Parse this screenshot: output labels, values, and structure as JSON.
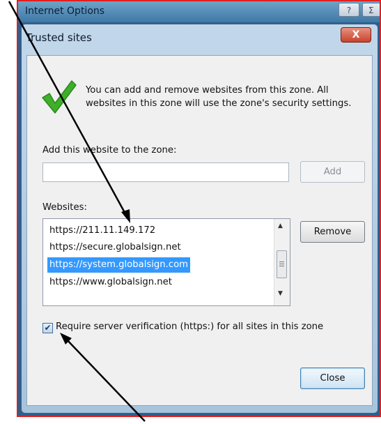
{
  "outer_window": {
    "title": "Internet Options",
    "help_button": "?",
    "close_button_partial": "Σ"
  },
  "dialog": {
    "title": "Trusted sites",
    "close_button": "X",
    "info_text": "You can add and remove websites from this zone. All websites in this zone will use the zone's security settings.",
    "add_label": "Add this website to the zone:",
    "site_input_value": "",
    "add_button": "Add",
    "websites_label": "Websites:",
    "websites": [
      "https://211.11.149.172",
      "https://secure.globalsign.net",
      "https://system.globalsign.com",
      "https://www.globalsign.net"
    ],
    "selected_website": "https://system.globalsign.com",
    "remove_button": "Remove",
    "require_verification": {
      "checked": true,
      "label": "Require server verification (https:) for all sites in this zone"
    },
    "close_label": "Close"
  },
  "icons": {
    "checkmark": "checkmark-icon",
    "check_color": "#3fae2a"
  },
  "colors": {
    "selection": "#3399ff",
    "outer_border": "#e02020"
  }
}
